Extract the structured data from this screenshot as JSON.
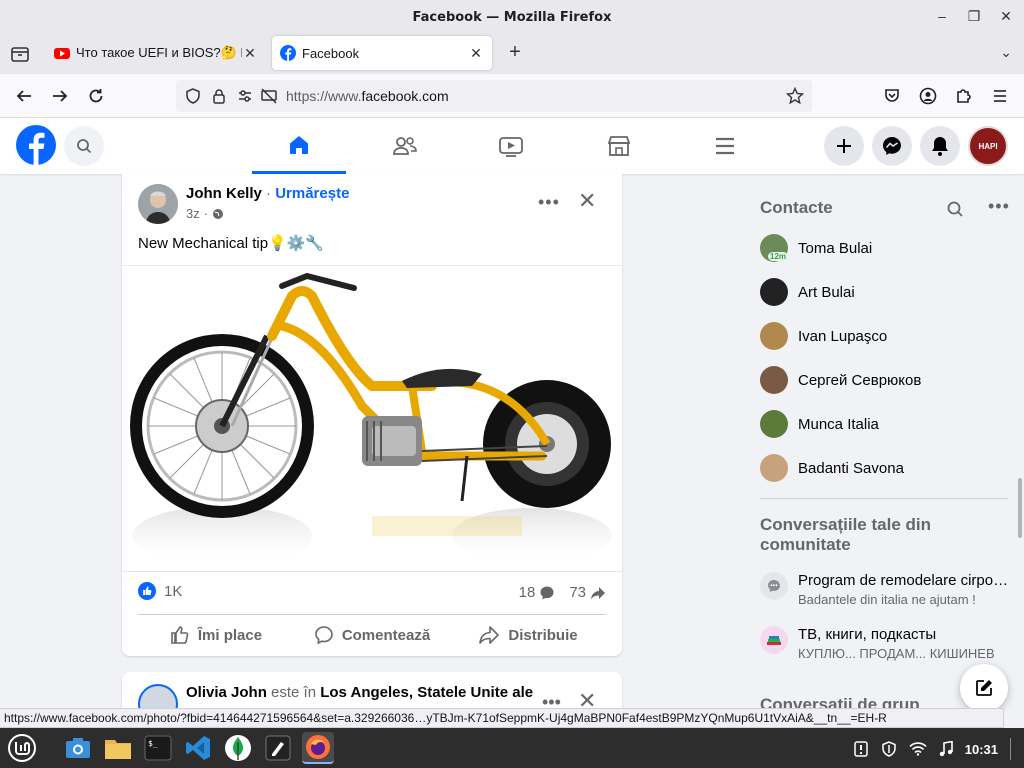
{
  "window": {
    "title": "Facebook — Mozilla Firefox"
  },
  "tabs": [
    {
      "label": "Что такое UEFI и BIOS?🤔 Ка",
      "favicon": "youtube-icon"
    },
    {
      "label": "Facebook",
      "favicon": "facebook-icon",
      "active": true
    }
  ],
  "urlbar": {
    "prefix": "https://www.",
    "domain": "facebook.com"
  },
  "post": {
    "author": "John Kelly",
    "separator": " · ",
    "follow_label": "Urmărește",
    "time": "3z",
    "text": "New Mechanical tip💡⚙️🔧",
    "likes": "1K",
    "comments": "18",
    "shares": "73",
    "like_label": "Îmi place",
    "comment_label": "Comentează",
    "share_label": "Distribuie"
  },
  "post2": {
    "author": "Olivia John",
    "connector": " este în ",
    "location": "Los Angeles, Statele Unite ale"
  },
  "contacts": {
    "heading": "Contacte",
    "items": [
      {
        "name": "Toma Bulai",
        "badge": "12m",
        "color": "#6d8b5a"
      },
      {
        "name": "Art Bulai",
        "color": "#222222"
      },
      {
        "name": "Ivan Lupaşco",
        "color": "#b0894f"
      },
      {
        "name": "Сергей Севрюков",
        "color": "#7a5a44"
      },
      {
        "name": "Munca Italia",
        "color": "#5c7a3a"
      },
      {
        "name": "Badanti Savona",
        "color": "#c7a27c"
      }
    ]
  },
  "conversations": {
    "heading_line1": "Conversațiile tale din",
    "heading_line2": "comunitate",
    "items": [
      {
        "title": "Program de remodelare cirpo…",
        "subtitle": "Badantele din italia ne ajutam !"
      },
      {
        "title": "ТВ, книги, подкасты",
        "subtitle": "КУПЛЮ... ПРОДАМ... КИШИНЕВ"
      }
    ],
    "group_heading": "Conversații de grup"
  },
  "statusbar": {
    "url": "https://www.facebook.com/photo/?fbid=414644271596564&set=a.329266036…yTBJm-K71ofSeppmK-Uj4gMaBPN0Faf4estB9PMzYQnMup6U1tVxAiA&__tn__=EH-R"
  },
  "taskbar": {
    "clock": "10:31"
  },
  "colors": {
    "fb_blue": "#0866ff",
    "text_grey": "#65676b"
  }
}
